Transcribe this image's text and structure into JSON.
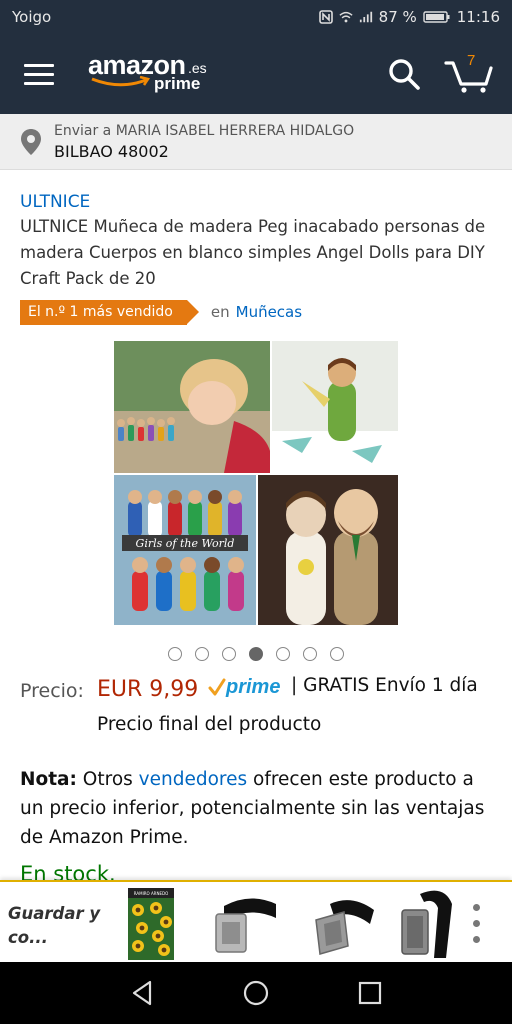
{
  "status_bar": {
    "carrier": "Yoigo",
    "battery": "87 %",
    "time": "11:16",
    "icons": [
      "nfc-icon",
      "wifi-icon",
      "signal-icon",
      "battery-icon"
    ]
  },
  "header": {
    "logo_text": "amazon",
    "logo_suffix": ".es",
    "logo_prime": "prime",
    "cart_count": "7",
    "colors": {
      "background": "#232f3e",
      "accent": "#f08804"
    }
  },
  "delivery": {
    "line1": "Enviar a MARIA ISABEL HERRERA HIDALGO",
    "line2": "BILBAO 48002"
  },
  "product": {
    "brand": "ULTNICE",
    "title": "ULTNICE Muñeca de madera Peg inacabado personas de madera Cuerpos en blanco simples Angel Dolls para DIY Craft Pack de 20",
    "badge": "El n.º 1 más vendido",
    "badge_in": "en",
    "badge_category": "Muñecas",
    "image_banner": "Girls of the World",
    "carousel": {
      "count": 7,
      "active_index": 3
    }
  },
  "price": {
    "label": "Precio:",
    "value": "EUR 9,99",
    "prime_label": "prime",
    "shipping": "| GRATIS Envío 1 día",
    "final": "Precio final del producto"
  },
  "note": {
    "bold": "Nota:",
    "text_before": " Otros ",
    "link": "vendedores",
    "text_after": " ofrecen este producto a un precio inferior, potencialmente sin las ventajas de Amazon Prime."
  },
  "stock": "En stock.",
  "saved_bar": {
    "label_line1": "Guardar y",
    "label_line2": "co...",
    "thumb1_text": "RAMIRO ARNEDO",
    "items": [
      "sunflower-seed-packet",
      "belt-1",
      "belt-2",
      "belt-3"
    ]
  },
  "nav": {
    "icons": [
      "back-icon",
      "home-icon",
      "recents-icon"
    ]
  }
}
